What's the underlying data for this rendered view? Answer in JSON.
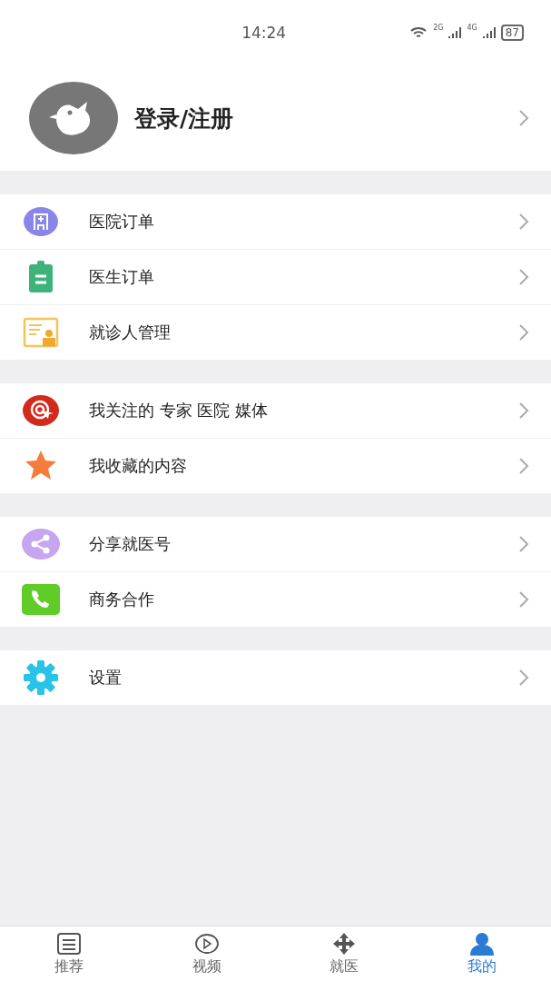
{
  "status_bar": {
    "time": "14:24",
    "signal_1": "2G",
    "signal_2": "4G",
    "battery": "87"
  },
  "profile": {
    "title": "登录/注册"
  },
  "sections": [
    {
      "items": [
        {
          "label": "医院订单",
          "kind": "hospital"
        },
        {
          "label": "医生订单",
          "kind": "clipboard"
        },
        {
          "label": "就诊人管理",
          "kind": "patient"
        }
      ]
    },
    {
      "items": [
        {
          "label": "我关注的 专家 医院 媒体",
          "kind": "target"
        },
        {
          "label": "我收藏的内容",
          "kind": "star"
        }
      ]
    },
    {
      "items": [
        {
          "label": "分享就医号",
          "kind": "share"
        },
        {
          "label": "商务合作",
          "kind": "phone"
        }
      ]
    },
    {
      "items": [
        {
          "label": "设置",
          "kind": "gear"
        }
      ]
    }
  ],
  "tabs": [
    {
      "label": "推荐",
      "kind": "list",
      "selected": false
    },
    {
      "label": "视频",
      "kind": "play",
      "selected": false
    },
    {
      "label": "就医",
      "kind": "cross",
      "selected": false
    },
    {
      "label": "我的",
      "kind": "person",
      "selected": true
    }
  ]
}
